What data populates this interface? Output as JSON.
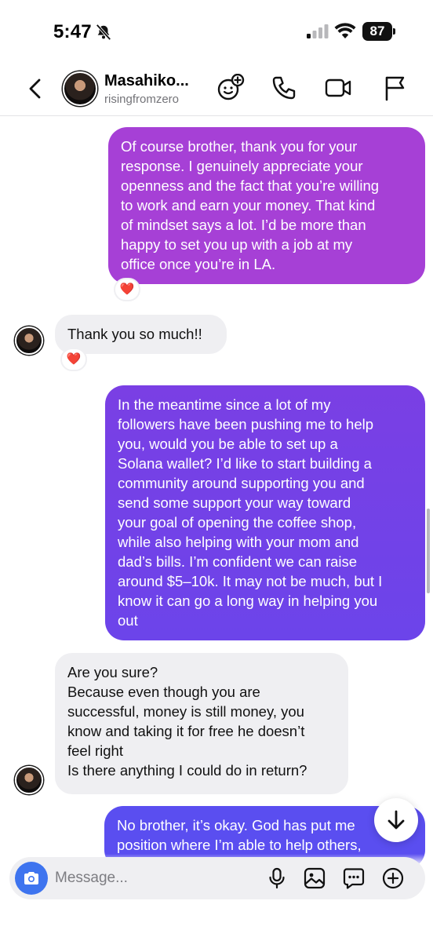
{
  "status_bar": {
    "time": "5:47",
    "battery": "87"
  },
  "header": {
    "name": "Masahiko...",
    "username": "risingfromzero"
  },
  "messages": [
    {
      "lines": [
        "Of course brother, thank you for your",
        "response. I genuinely appreciate your",
        "openness and the fact that you’re willing",
        "to work and earn your money. That kind",
        "of mindset says a lot. I’d be more than",
        "happy to set you up with a job at my",
        "office once you’re in LA."
      ],
      "reaction": "❤️"
    },
    {
      "lines": [
        "Thank you so much!!"
      ],
      "reaction": "❤️"
    },
    {
      "lines": [
        "In the meantime since a lot of my",
        "followers have been pushing me to help",
        "you, would you be able to set up a",
        "Solana wallet? I’d like to start building a",
        "community around supporting you and",
        "send some support your way toward",
        "your goal of opening the coffee shop,",
        "while also helping with your mom and",
        "dad’s bills. I’m confident we can raise",
        "around $5–10k. It may not be much, but I",
        "know it can go a long way in helping you",
        "out"
      ]
    },
    {
      "lines": [
        "Are you sure?",
        "Because even though you are",
        "successful, money is still money, you",
        "know and taking it for free he doesn’t",
        "feel right",
        "Is there anything I could do in return?"
      ]
    },
    {
      "lines": [
        "No brother, it’s okay. God has put me",
        "position where I’m able to help others,"
      ]
    }
  ],
  "composer": {
    "placeholder": "Message..."
  },
  "icons": {
    "silent": "bell-slash-icon",
    "signal": "cellular-signal-icon",
    "wifi": "wifi-icon",
    "back": "chevron-left-icon",
    "effects": "add-effects-icon",
    "phone": "phone-icon",
    "video": "video-icon",
    "flag": "flag-icon",
    "camera": "camera-icon",
    "mic": "microphone-icon",
    "gallery": "gallery-icon",
    "sticker": "chat-bubble-icon",
    "add": "plus-circle-icon",
    "scroll_down": "arrow-down-icon"
  },
  "colors": {
    "outgoing_top": "#a640d6",
    "outgoing_mid": "#6c44ea",
    "outgoing_bottom": "#5a4ef0",
    "incoming": "#efeff2",
    "camera": "#3e74ef"
  }
}
